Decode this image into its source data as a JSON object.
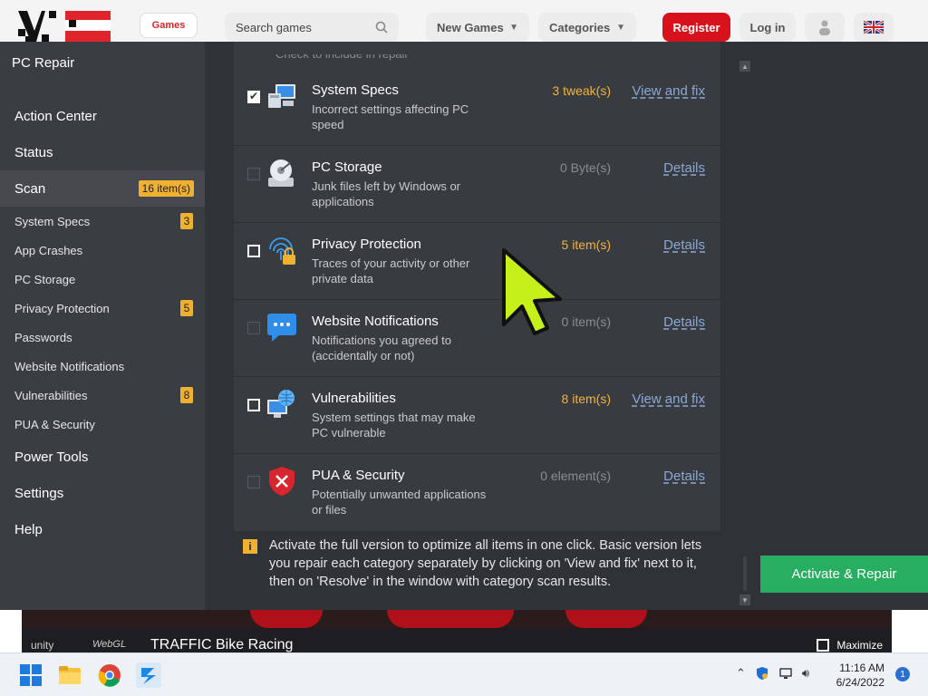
{
  "website": {
    "games_tab": "Games",
    "search_placeholder": "Search games",
    "new_games": "New Games",
    "categories": "Categories",
    "register": "Register",
    "login": "Log in"
  },
  "app": {
    "title": "PC Repair",
    "nav": {
      "action_center": "Action Center",
      "status": "Status",
      "scan": "Scan",
      "scan_badge": "16 item(s)",
      "power_tools": "Power Tools",
      "settings": "Settings",
      "help": "Help"
    },
    "subnav": [
      {
        "label": "System Specs",
        "badge": "3"
      },
      {
        "label": "App Crashes",
        "badge": ""
      },
      {
        "label": "PC Storage",
        "badge": ""
      },
      {
        "label": "Privacy Protection",
        "badge": "5"
      },
      {
        "label": "Passwords",
        "badge": ""
      },
      {
        "label": "Website Notifications",
        "badge": ""
      },
      {
        "label": "Vulnerabilities",
        "badge": "8"
      },
      {
        "label": "PUA & Security",
        "badge": ""
      }
    ],
    "list_header_cut": "Check to include in repair",
    "rows": [
      {
        "title": "System Specs",
        "desc": "Incorrect settings affecting PC speed",
        "count": "3 tweak(s)",
        "action": "View and fix",
        "icon": "computer-icon"
      },
      {
        "title": "PC Storage",
        "desc": "Junk files left by Windows or applications",
        "count": "0 Byte(s)",
        "action": "Details",
        "icon": "disk-icon"
      },
      {
        "title": "Privacy Protection",
        "desc": "Traces of your activity or other private data",
        "count": "5 item(s)",
        "action": "Details",
        "icon": "fingerprint-lock-icon"
      },
      {
        "title": "Website Notifications",
        "desc": "Notifications you agreed to (accidentally or not)",
        "count": "0 item(s)",
        "action": "Details",
        "icon": "chat-bubble-icon"
      },
      {
        "title": "Vulnerabilities",
        "desc": "System settings that may make PC vulnerable",
        "count": "8 item(s)",
        "action": "View and fix",
        "icon": "globe-computer-icon"
      },
      {
        "title": "PUA & Security",
        "desc": "Potentially unwanted applications or files",
        "count": "0 element(s)",
        "action": "Details",
        "icon": "shield-x-icon"
      }
    ],
    "notice": "Activate the full version to optimize all items in one click. Basic version lets you repair each category separately by clicking on 'View and fix' next to it, then on 'Resolve' in the window with category scan results.",
    "activate_button": "Activate & Repair"
  },
  "game": {
    "unity": "unity",
    "webgl": "WebGL",
    "title": "TRAFFIC Bike Racing",
    "maximize": "Maximize"
  },
  "taskbar": {
    "time": "11:16 AM",
    "date": "6/24/2022",
    "notifications": "1"
  },
  "colors": {
    "accent_orange": "#f0b030",
    "activate_green": "#27ae60",
    "register_red": "#d8121c",
    "link_blue": "#8aa8d6"
  }
}
